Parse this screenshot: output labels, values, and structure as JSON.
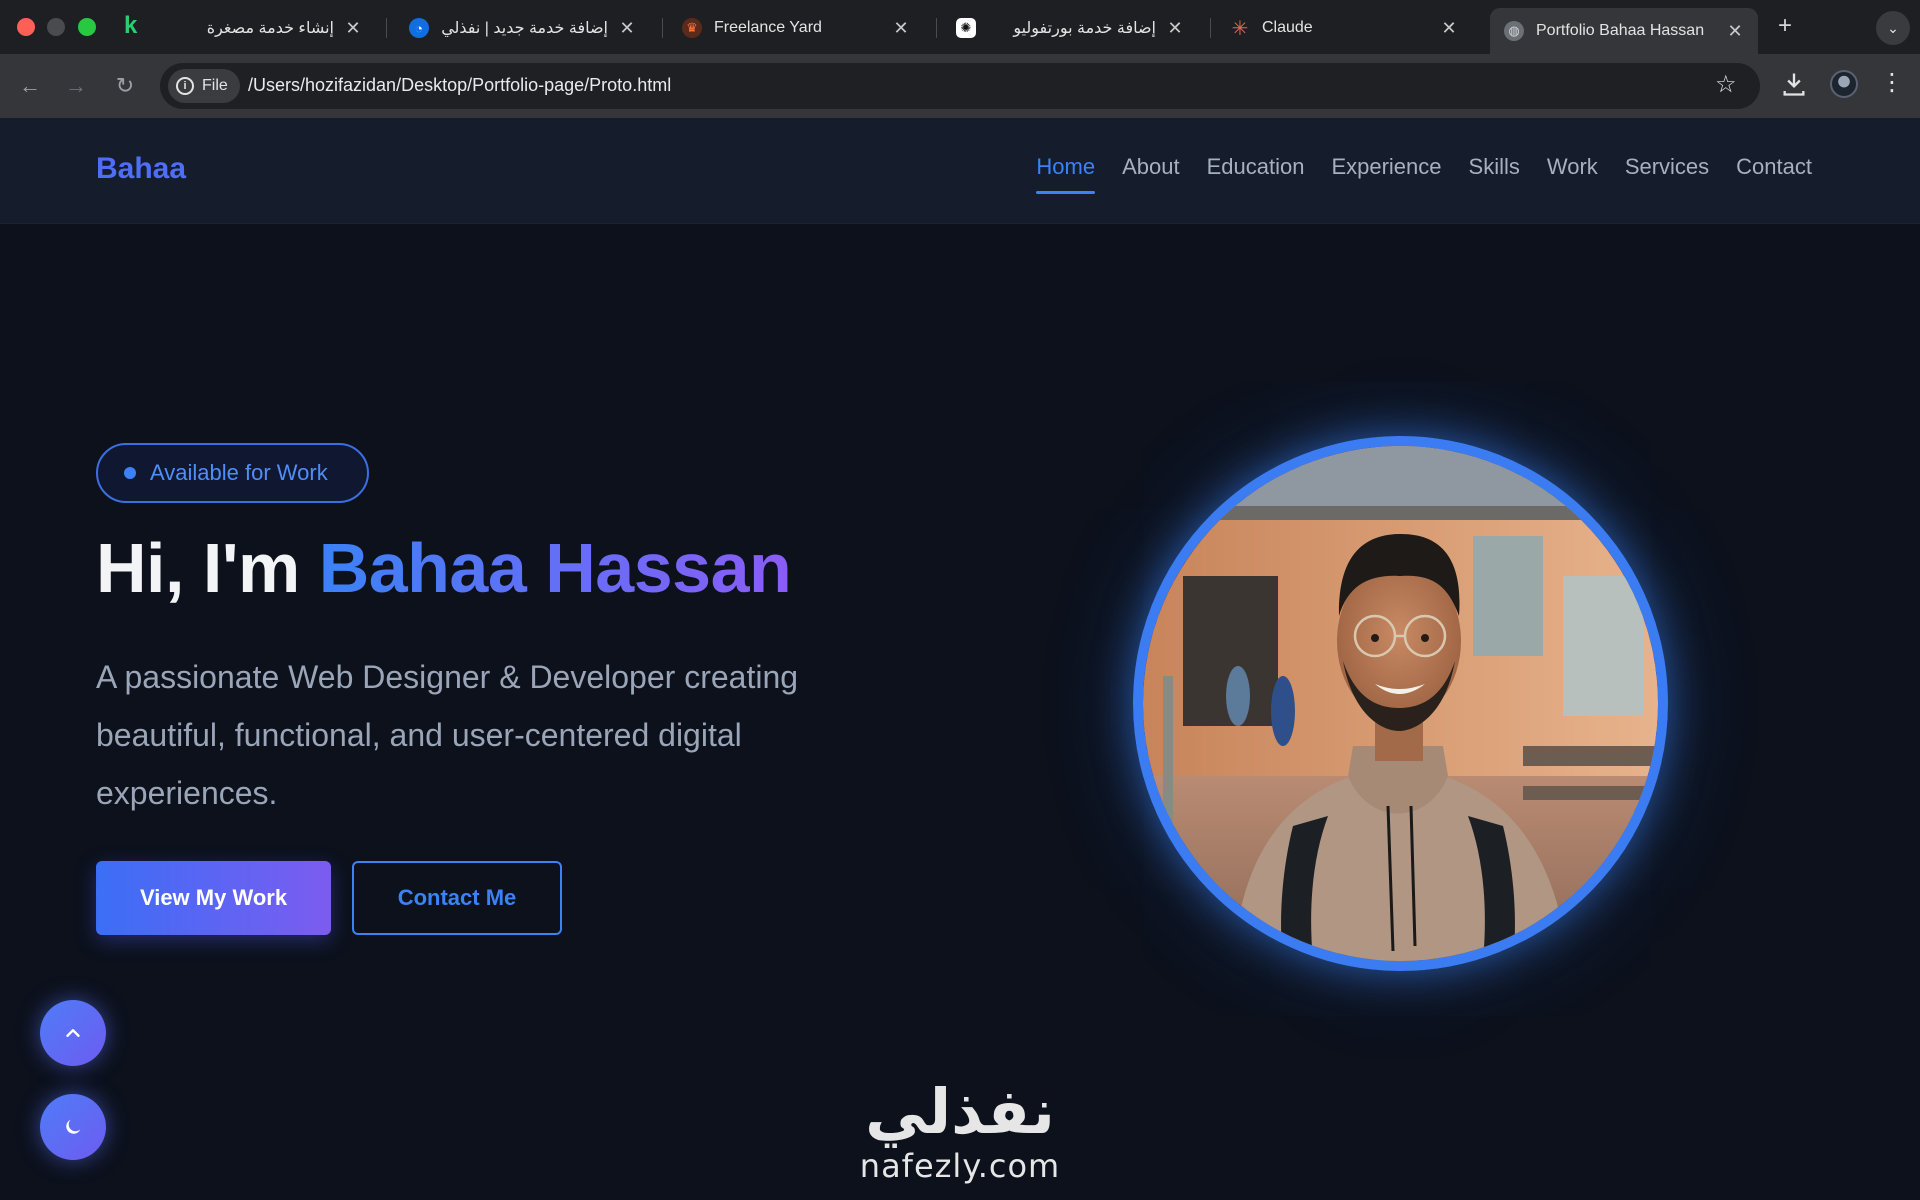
{
  "browser": {
    "tabs": [
      {
        "title": "إنشاء خدمة مصغرة",
        "icon": "khamsat-icon",
        "rtl": true
      },
      {
        "title": "إضافة خدمة جديد | نفذلي",
        "icon": "nafezly-icon",
        "rtl": true
      },
      {
        "title": "Freelance Yard",
        "icon": "freelance-yard-icon",
        "rtl": false
      },
      {
        "title": "إضافة خدمة بورتفوليو",
        "icon": "chatgpt-icon",
        "rtl": true
      },
      {
        "title": "Claude",
        "icon": "claude-icon",
        "rtl": false
      },
      {
        "title": "Portfolio Bahaa Hassan",
        "icon": "globe-icon",
        "rtl": false,
        "active": true
      }
    ],
    "address": {
      "scheme_chip": "File",
      "url": "/Users/hozifazidan/Desktop/Portfolio-page/Proto.html"
    }
  },
  "site": {
    "brand": "Bahaa",
    "nav": [
      {
        "label": "Home",
        "active": true
      },
      {
        "label": "About"
      },
      {
        "label": "Education"
      },
      {
        "label": "Experience"
      },
      {
        "label": "Skills"
      },
      {
        "label": "Work"
      },
      {
        "label": "Services"
      },
      {
        "label": "Contact"
      }
    ],
    "hero": {
      "badge": "Available for Work",
      "greeting": "Hi, I'm ",
      "name": "Bahaa Hassan",
      "description": "A passionate Web Designer & Developer creating beautiful, functional, and user-centered digital experiences.",
      "primary_cta": "View My Work",
      "secondary_cta": "Contact Me"
    },
    "floating": {
      "scroll_top_icon": "chevron-up-icon",
      "theme_toggle_icon": "moon-icon"
    },
    "watermark": {
      "arabic": "نفذلي",
      "latin": "nafezly.com"
    },
    "colors": {
      "accent": "#3b82f6",
      "accent_purple": "#8b5cf6",
      "background": "#0c111c"
    }
  }
}
